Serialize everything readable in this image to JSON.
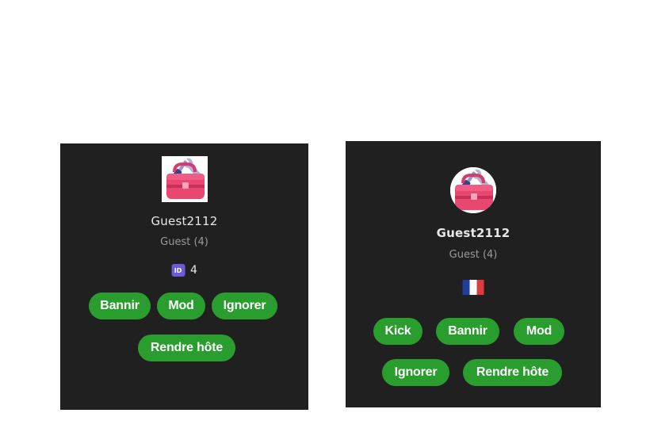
{
  "cards": [
    {
      "avatar_icon": "toolbox-icon",
      "username": "Guest2112",
      "subtitle": "Guest (4)",
      "id_badge_label": "ID",
      "id_value": "4",
      "buttons": {
        "ban": "Bannir",
        "mod": "Mod",
        "ignore": "Ignorer",
        "make_host": "Rendre hôte"
      }
    },
    {
      "avatar_icon": "toolbox-icon",
      "username": "Guest2112",
      "subtitle": "Guest (4)",
      "flag_icon": "france-flag-icon",
      "flag_colors": [
        "#1f3f9a",
        "#ffffff",
        "#e03a3e"
      ],
      "buttons": {
        "kick": "Kick",
        "ban": "Bannir",
        "mod": "Mod",
        "ignore": "Ignorer",
        "make_host": "Rendre hôte"
      }
    }
  ],
  "colors": {
    "card_background": "#202020",
    "button_green": "#2a9d2f",
    "id_badge": "#6b5bd6"
  }
}
